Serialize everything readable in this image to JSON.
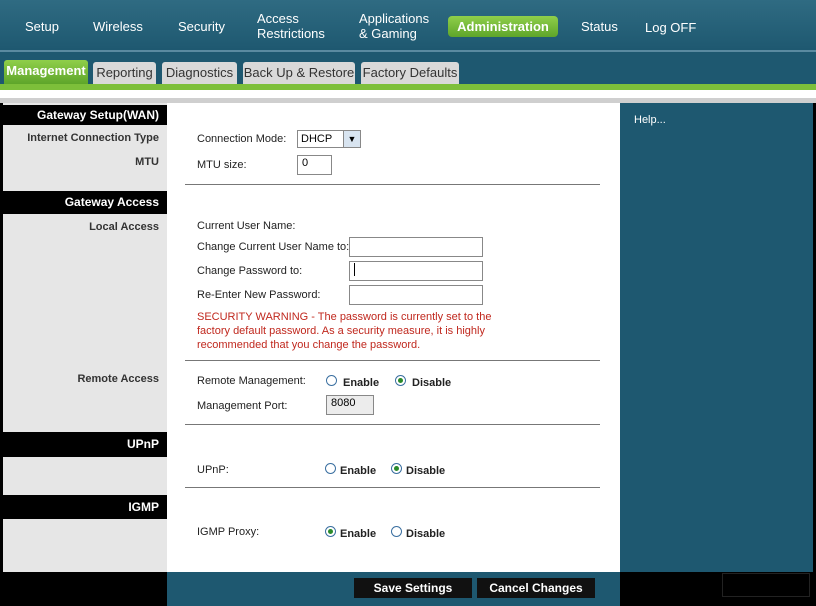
{
  "topnav": {
    "items": [
      {
        "label": "Setup"
      },
      {
        "label": "Wireless"
      },
      {
        "label": "Security"
      },
      {
        "label": "Access\nRestrictions"
      },
      {
        "label": "Applications\n& Gaming"
      },
      {
        "label": "Administration"
      },
      {
        "label": "Status"
      },
      {
        "label": "Log OFF"
      }
    ],
    "active": "Administration"
  },
  "tabs": [
    {
      "label": "Management"
    },
    {
      "label": "Reporting"
    },
    {
      "label": "Diagnostics"
    },
    {
      "label": "Back Up & Restore"
    },
    {
      "label": "Factory Defaults"
    }
  ],
  "left": {
    "gateway_setup": "Gateway Setup(WAN)",
    "internet_connection_type": "Internet Connection Type",
    "mtu": "MTU",
    "gateway_access": "Gateway Access",
    "local_access": "Local Access",
    "remote_access": "Remote Access",
    "upnp": "UPnP",
    "igmp": "IGMP"
  },
  "form": {
    "connection_mode_label": "Connection Mode:",
    "connection_mode_value": "DHCP",
    "mtu_label": "MTU size:",
    "mtu_value": "0",
    "current_user_label": "Current User Name:",
    "change_user_label": "Change Current User Name to:",
    "change_password_label": "Change Password to:",
    "reenter_password_label": "Re-Enter New Password:",
    "warning": "SECURITY WARNING - The password is currently set to the factory default password. As a security measure, it is highly recommended that you change the password.",
    "remote_mgmt_label": "Remote Management:",
    "mgmt_port_label": "Management Port:",
    "mgmt_port_value": "8080",
    "upnp_label": "UPnP:",
    "igmp_label": "IGMP Proxy:",
    "enable": "Enable",
    "disable": "Disable"
  },
  "help": {
    "label": "Help..."
  },
  "buttons": {
    "save": "Save Settings",
    "cancel": "Cancel Changes"
  }
}
